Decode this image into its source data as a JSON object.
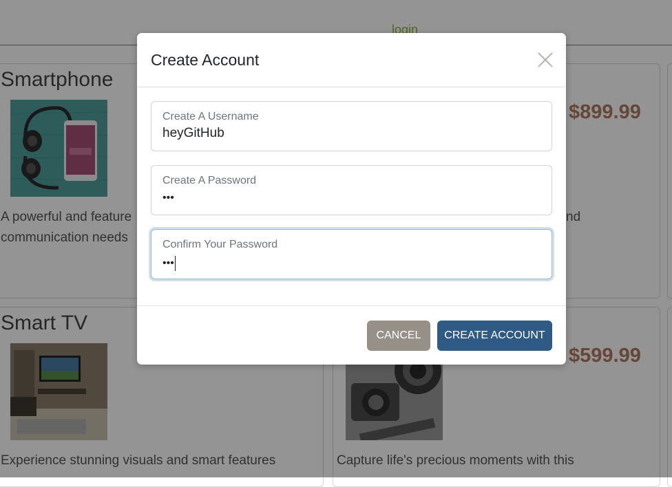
{
  "nav": {
    "login_label": "login"
  },
  "products": [
    {
      "title": "Smartphone",
      "price": "$899.99",
      "desc_lines": [
        "A powerful and feature",
        "communication needs"
      ],
      "desc_right": "nd"
    },
    {
      "title": "Smart TV",
      "price": "$599.99",
      "desc_lines": [
        "Experience stunning visuals and smart features"
      ]
    },
    {
      "desc_lines": [
        "Capture life's precious moments with this"
      ]
    }
  ],
  "modal": {
    "title": "Create Account",
    "fields": [
      {
        "label": "Create A Username",
        "value": "heyGitHub"
      },
      {
        "label": "Create A Password",
        "value": "•••"
      },
      {
        "label": "Confirm Your Password",
        "value": "•••"
      }
    ],
    "cancel_label": "CANCEL",
    "create_label": "CREATE ACCOUNT"
  },
  "colors": {
    "create_button": "#2f5a85",
    "cancel_button": "#969088",
    "price": "#b07b5f",
    "login": "#8bb33b"
  }
}
